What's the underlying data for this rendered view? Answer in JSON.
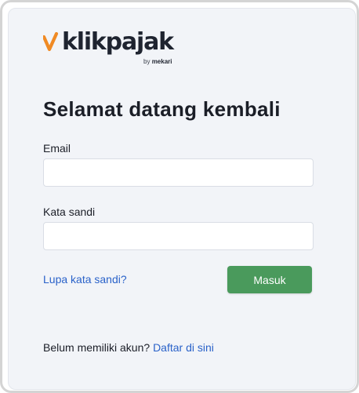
{
  "brand": {
    "name": "klikpajak",
    "byline_prefix": "by",
    "byline_company": "mekari",
    "mark_color": "#f08a24"
  },
  "login": {
    "title": "Selamat datang kembali",
    "email_label": "Email",
    "email_value": "",
    "password_label": "Kata sandi",
    "password_value": "",
    "forgot_link": "Lupa kata sandi?",
    "submit_label": "Masuk"
  },
  "signup": {
    "prompt": "Belum memiliki akun?",
    "link": "Daftar di sini"
  },
  "colors": {
    "accent_green": "#4a9a5c",
    "link_blue": "#2a62c9",
    "card_background": "#f2f4f8"
  }
}
